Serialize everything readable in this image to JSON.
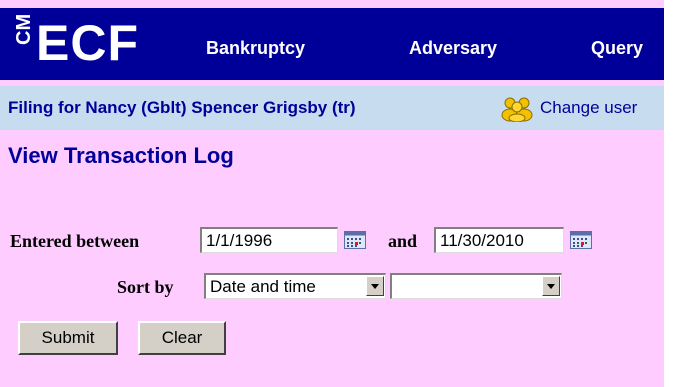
{
  "header": {
    "logo_cm": "CM",
    "logo_ecf": "ECF",
    "nav": [
      "Bankruptcy",
      "Adversary",
      "Query"
    ]
  },
  "filing": {
    "text": "Filing for Nancy (Gblt) Spencer Grigsby (tr)",
    "change_user": "Change user"
  },
  "page_title": "View Transaction Log",
  "form": {
    "entered_between_label": "Entered between",
    "start_date": "1/1/1996",
    "and_label": "and",
    "end_date": "11/30/2010",
    "sort_by_label": "Sort by",
    "sort_primary": "Date and time",
    "sort_secondary": "",
    "submit_label": "Submit",
    "clear_label": "Clear"
  },
  "colors": {
    "nav_bg": "#000099",
    "filing_bg": "#c8dcf0",
    "page_bg": "#ffccff"
  }
}
